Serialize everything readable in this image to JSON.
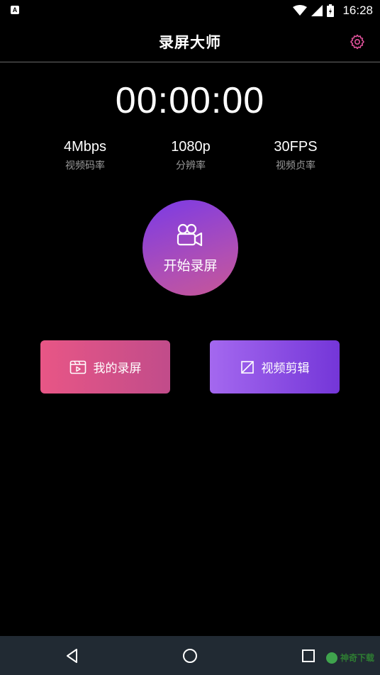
{
  "status_bar": {
    "time": "16:28",
    "left_badge": "A"
  },
  "app_bar": {
    "title": "录屏大师"
  },
  "timer": {
    "value": "00:00:00"
  },
  "stats": [
    {
      "value": "4Mbps",
      "label": "视频码率"
    },
    {
      "value": "1080p",
      "label": "分辨率"
    },
    {
      "value": "30FPS",
      "label": "视频贞率"
    }
  ],
  "record_button": {
    "label": "开始录屏"
  },
  "actions": {
    "my_records_label": "我的录屏",
    "video_edit_label": "视频剪辑"
  },
  "colors": {
    "settings_icon": "#e0529b",
    "my_records_gradient": [
      "#e85686",
      "#c14c8a"
    ],
    "video_edit_gradient": [
      "#a468ef",
      "#7436d8"
    ],
    "record_gradient": [
      "#7a3ae6",
      "#c75696"
    ],
    "nav_bar": "#212a33"
  },
  "watermark": {
    "text": "神奇下载"
  }
}
